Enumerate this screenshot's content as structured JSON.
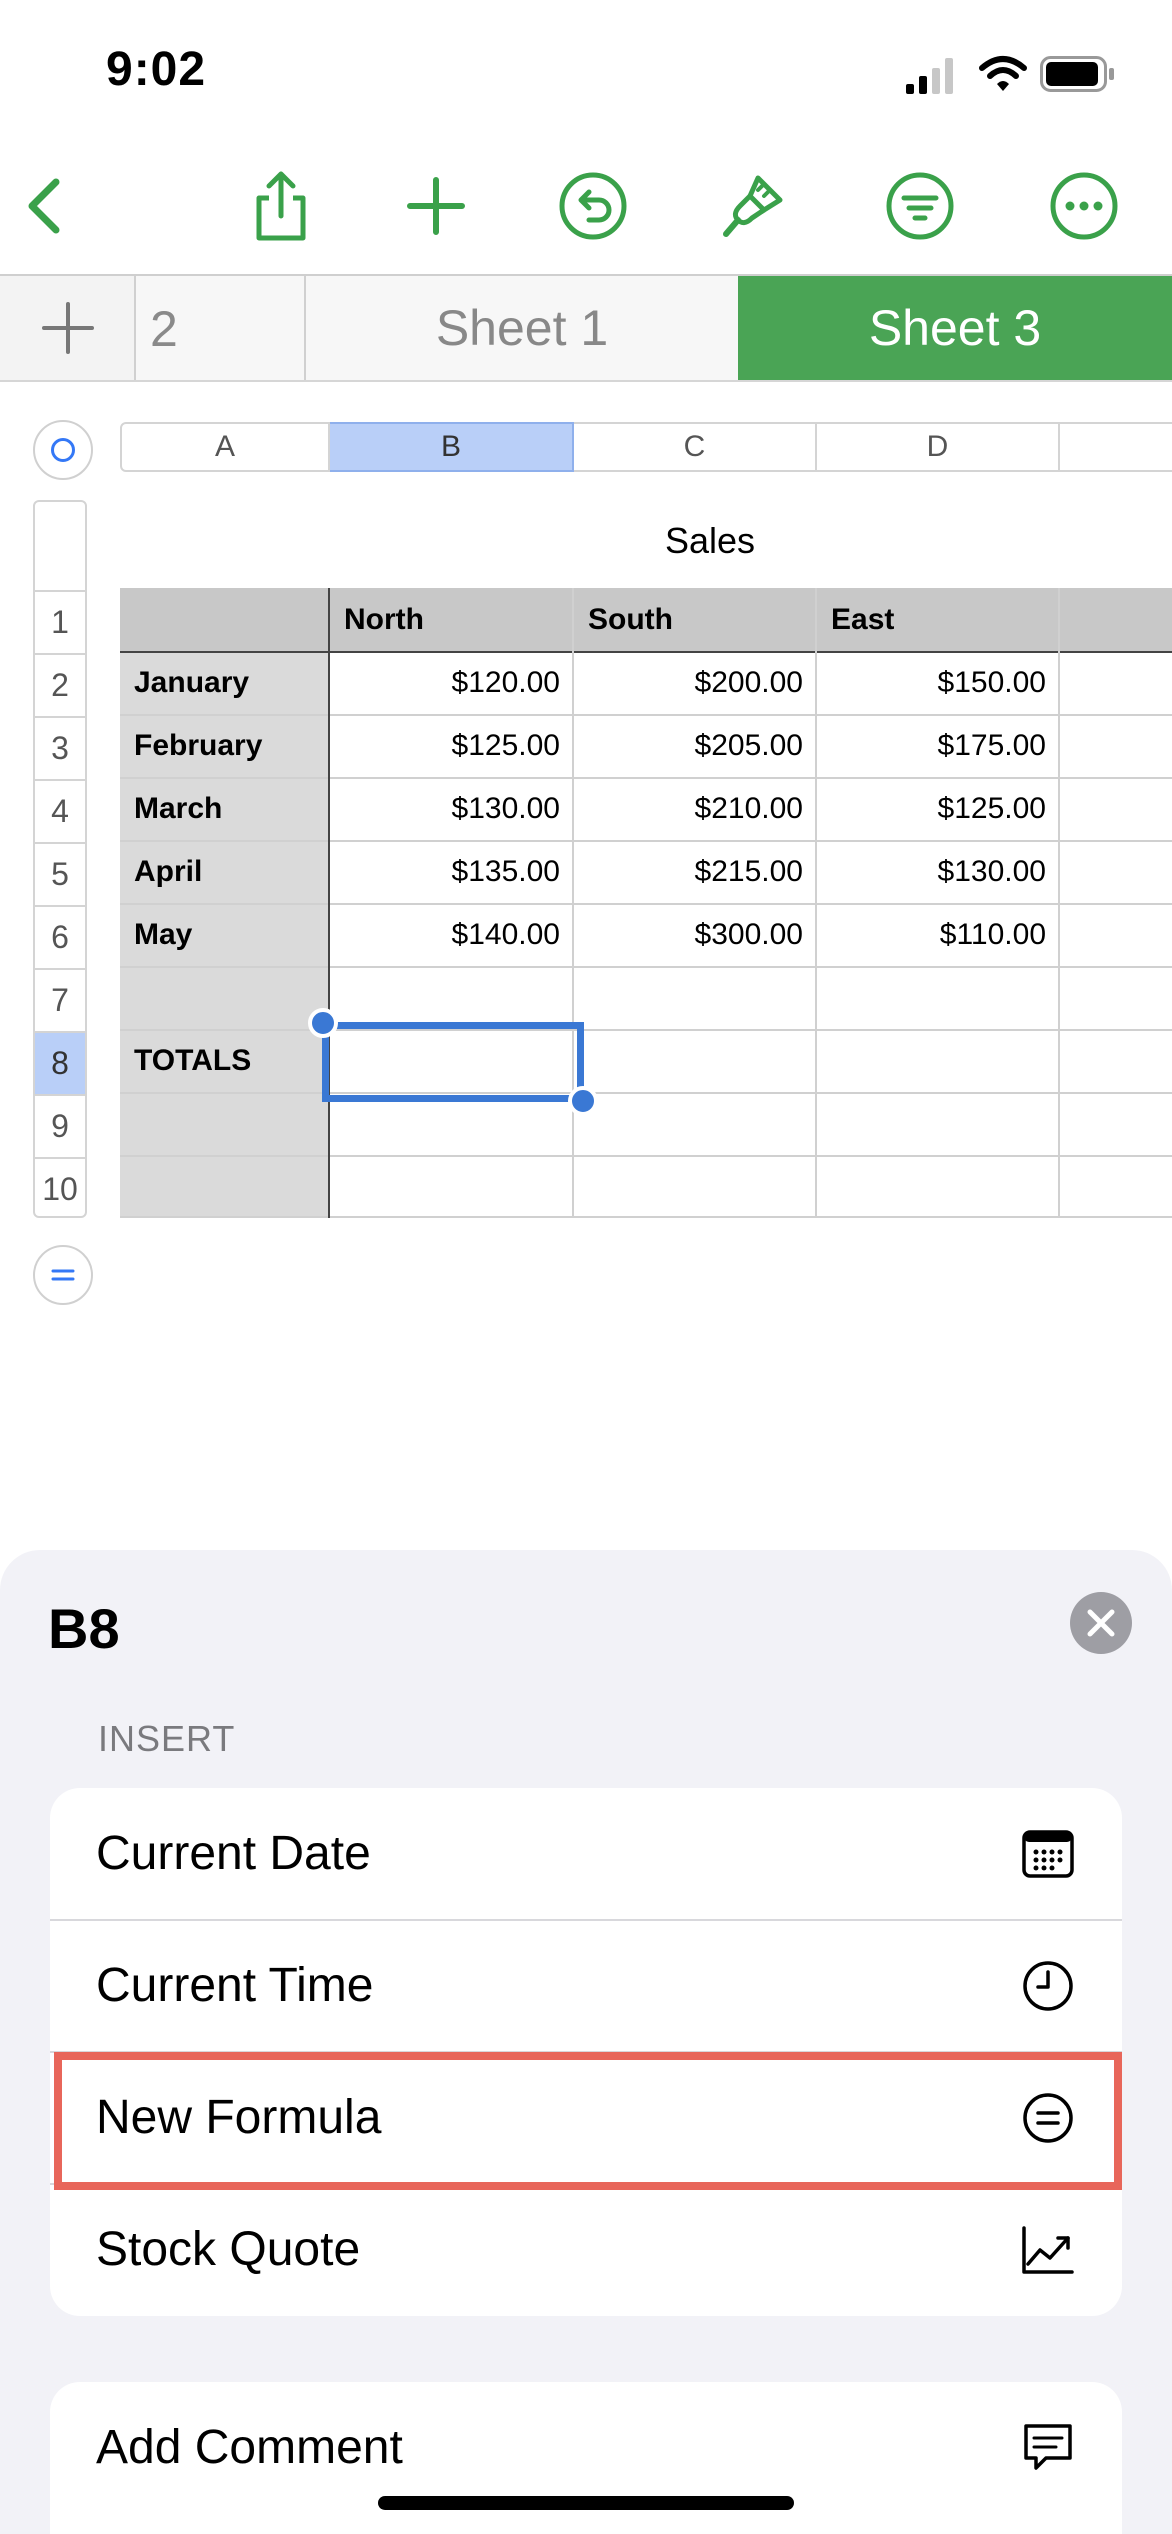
{
  "status_bar": {
    "time": "9:02"
  },
  "toolbar": {
    "icons": [
      "back-chevron-icon",
      "share-icon",
      "add-icon",
      "undo-icon",
      "format-brush-icon",
      "filter-icon",
      "more-icon"
    ],
    "accent_color": "#3aa14a"
  },
  "tabs": {
    "count_label": "2",
    "sheets": [
      {
        "label": "Sheet 1",
        "active": false
      },
      {
        "label": "Sheet 3",
        "active": true
      }
    ],
    "active_color": "#4aa455"
  },
  "spreadsheet": {
    "columns": [
      "A",
      "B",
      "C",
      "D"
    ],
    "selected_column": "B",
    "rows": [
      "1",
      "2",
      "3",
      "4",
      "5",
      "6",
      "7",
      "8",
      "9",
      "10"
    ],
    "selected_row": "8",
    "table_title": "Sales",
    "header_row": [
      "",
      "North",
      "South",
      "East"
    ],
    "body": [
      [
        "January",
        "$120.00",
        "$200.00",
        "$150.00"
      ],
      [
        "February",
        "$125.00",
        "$205.00",
        "$175.00"
      ],
      [
        "March",
        "$130.00",
        "$210.00",
        "$125.00"
      ],
      [
        "April",
        "$135.00",
        "$215.00",
        "$130.00"
      ],
      [
        "May",
        "$140.00",
        "$300.00",
        "$110.00"
      ],
      [
        "",
        "",
        "",
        ""
      ],
      [
        "TOTALS",
        "",
        "",
        ""
      ],
      [
        "",
        "",
        "",
        ""
      ],
      [
        "",
        "",
        "",
        ""
      ]
    ],
    "selected_cell": "B8",
    "selection_color": "#3a78d4"
  },
  "bottom_sheet": {
    "title": "B8",
    "section_label": "INSERT",
    "insert_items": [
      {
        "label": "Current Date",
        "icon": "calendar-icon"
      },
      {
        "label": "Current Time",
        "icon": "clock-icon"
      },
      {
        "label": "New Formula",
        "icon": "formula-equals-icon"
      },
      {
        "label": "Stock Quote",
        "icon": "stock-chart-icon"
      }
    ],
    "other_items": [
      {
        "label": "Add Comment",
        "icon": "comment-icon"
      }
    ],
    "highlighted_item": "New Formula",
    "highlight_color": "#e8665a"
  }
}
